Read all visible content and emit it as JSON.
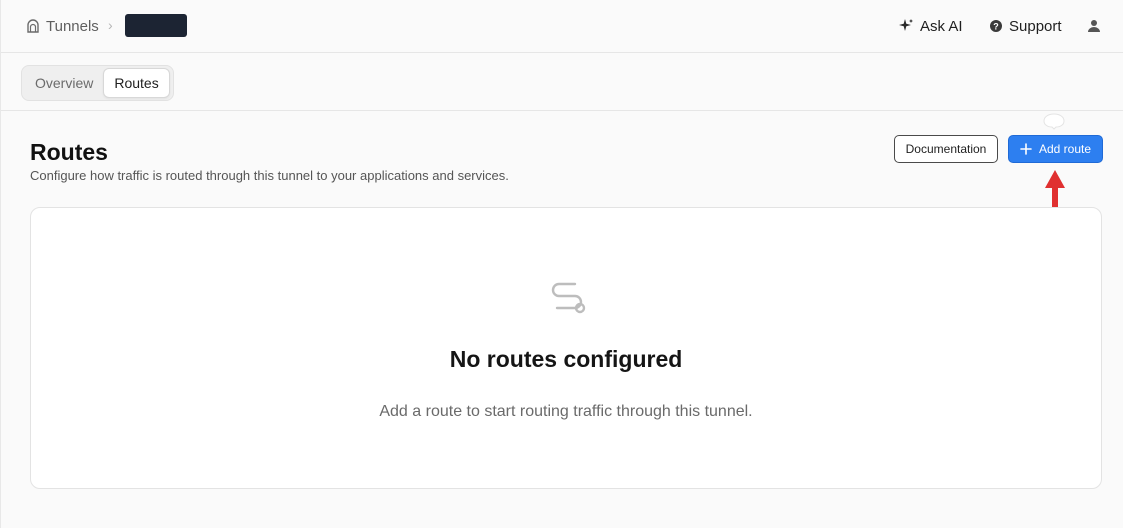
{
  "breadcrumb": {
    "root": "Tunnels",
    "separator": "›"
  },
  "top_actions": {
    "ask_ai": "Ask AI",
    "support": "Support"
  },
  "tabs": [
    {
      "label": "Overview",
      "active": false
    },
    {
      "label": "Routes",
      "active": true
    }
  ],
  "header": {
    "title": "Routes",
    "subtitle": "Configure how traffic is routed through this tunnel to your applications and services.",
    "documentation_label": "Documentation",
    "add_route_label": "Add route"
  },
  "empty_state": {
    "title": "No routes configured",
    "description": "Add a route to start routing traffic through this tunnel."
  },
  "icons": {
    "tunnel": "tunnel-icon",
    "sparkle": "sparkle-icon",
    "help": "help-circle-icon",
    "user": "user-icon",
    "plus": "plus-icon",
    "route": "route-icon"
  },
  "colors": {
    "accent": "#2d7ff0",
    "annotation_arrow": "#e03030"
  }
}
